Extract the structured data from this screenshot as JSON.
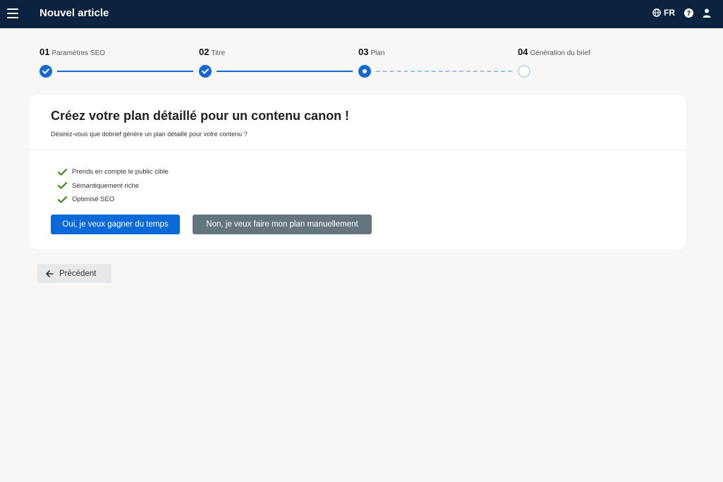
{
  "header": {
    "title": "Nouvel article",
    "language": "FR"
  },
  "stepper": {
    "steps": [
      {
        "num": "01",
        "label": "Paramètres SEO",
        "state": "done"
      },
      {
        "num": "02",
        "label": "Titre",
        "state": "done"
      },
      {
        "num": "03",
        "label": "Plan",
        "state": "current"
      },
      {
        "num": "04",
        "label": "Génération du brief",
        "state": "todo"
      }
    ]
  },
  "card": {
    "title": "Créez votre plan détaillé pour un contenu canon !",
    "subtitle": "Désirez-vous que dobrief génère un plan détaillé pour votre contenu ?",
    "features": [
      "Prends en compte le public cible",
      "Sémantiquement riche",
      "Optimisé SEO"
    ],
    "yes_label": "Oui, je veux gagner du temps",
    "no_label": "Non, je veux faire mon plan manuellement"
  },
  "nav": {
    "prev_label": "Précédent"
  },
  "colors": {
    "topbar": "#0c2340",
    "primary": "#0b69d8",
    "secondary": "#657580",
    "check": "#3a8c1f"
  }
}
